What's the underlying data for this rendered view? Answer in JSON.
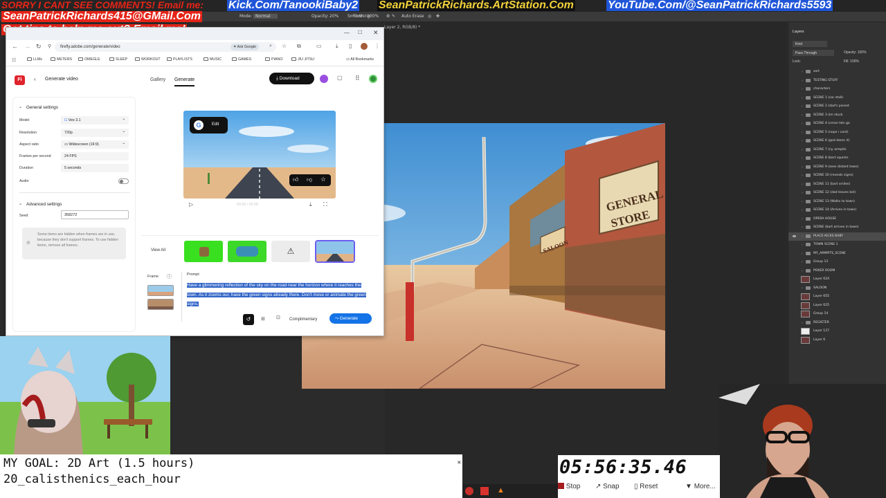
{
  "overlay": {
    "line1_prefix": "SORRY I CANT SEE COMMENTS! Email me:",
    "line1_kick": "Kick.Com/TanookiBaby2",
    "line1_artstation": "SeanPatrickRichards.ArtStation.Com",
    "line1_youtube": "YouTube.Com/@SeanPatrickRichards5593",
    "line2_email": "SeanPatrickRichards415@GMail.Com",
    "line3_tips": "Got tips to help me out? Email me!"
  },
  "photoshop": {
    "options": {
      "mode_label": "Mode:",
      "mode_value": "Normal",
      "opacity_label": "Opacity:",
      "opacity_value": "20%",
      "smoothing_label": "Smoothing:",
      "auto_erase": "Auto Erase"
    },
    "doc_tab": "Layer 2, RGB/8) *",
    "layers_title": "Layers",
    "kind_label": "Kind",
    "blend_mode": "Pass Through",
    "opacity_label": "Opacity:",
    "opacity_value": "100%",
    "lock_label": "Lock:",
    "fill_label": "Fill:",
    "fill_value": "100%",
    "layers": [
      "sort",
      "TESTING STUFF",
      "characters",
      "SCENE 1 (car stall)",
      "SCENE 2 (dad's pissed",
      "SCENE 3 (im stuck",
      "SCENE 4 (cmon lets go",
      "SCENE 5 (nope i cant)",
      "SCENE 6 (god damn it)",
      "SCENE 7 (ny armpits",
      "SCENE 8 (bart squints",
      "SCENE 9 (sees distant town)",
      "SCENE 10 (reveals signs)",
      "SCENE 11 (bart smiles)",
      "SCENE 12 (dad leaves kid)",
      "SCENE 13 (Walks to town)",
      "SCENE 14 (Arrives in town)",
      "OPERA HOUSE",
      "SCENE (bart arrives in town)",
      "PLACE KICKS BABY",
      "TOWN SCENE 1",
      "MY_ARMPITS_SCENE",
      "Group 13",
      "POKER ROOM",
      "Layer 624",
      "SALOON",
      "Layer 655",
      "Layer 625",
      "Group 14",
      "REGISTER",
      "Layer 127",
      "Layer 6"
    ]
  },
  "browser": {
    "url": "firefly.adobe.com/generate/video",
    "ask_google": "Ask Google",
    "bookmarks": [
      "LLMs",
      "METERS",
      "OMEGLE",
      "SLEEP",
      "WORKOUT",
      "PLAYLISTS",
      "MUSIC",
      "GAMES",
      "PIANO",
      "JIU JITSU"
    ],
    "all_bookmarks": "All Bookmarks",
    "app_logo": "Fi",
    "page_title": "Generate video",
    "tabs": {
      "gallery": "Gallery",
      "generate": "Generate"
    },
    "download_label": "Download",
    "general_settings": "General settings",
    "settings": [
      {
        "label": "Model",
        "value": "Veo 3.1"
      },
      {
        "label": "Resolution",
        "value": "720p"
      },
      {
        "label": "Aspect ratio",
        "value": "Widescreen (16:9)"
      },
      {
        "label": "Frames per second",
        "value": "24 FPS"
      },
      {
        "label": "Duration",
        "value": "5 seconds"
      }
    ],
    "audio_label": "Audio",
    "advanced_settings": "Advanced settings",
    "seed_label": "Seed",
    "seed_value": "358272",
    "hidden_notice": "Some items are hidden when frames are in use, because they don't support frames. To use hidden items, remove all frames.",
    "preview_edit": "Edit",
    "preview_time": "00:00 / 00:08",
    "view_all": "View All",
    "frame_label": "Frame",
    "prompt_label": "Prompt",
    "prompt_text": "Have a glimmering reflection of the sky on the road near the horizon where it reaches the town. As it zooms our, have the green signs already there. Don't move or animate the green signs.",
    "style_label": "Complimentary",
    "generate_label": "Generate"
  },
  "artwork": {
    "store_sign": "GENERAL STORE",
    "saloon_sign": "SALOON"
  },
  "goal": {
    "line1": "MY GOAL: 2D Art (1.5 hours)",
    "line2": "20_calisthenics_each_hour"
  },
  "timer": {
    "value": "05:56:35.46",
    "stop": "Stop",
    "snap": "Snap",
    "reset": "Reset",
    "more": "More..."
  }
}
